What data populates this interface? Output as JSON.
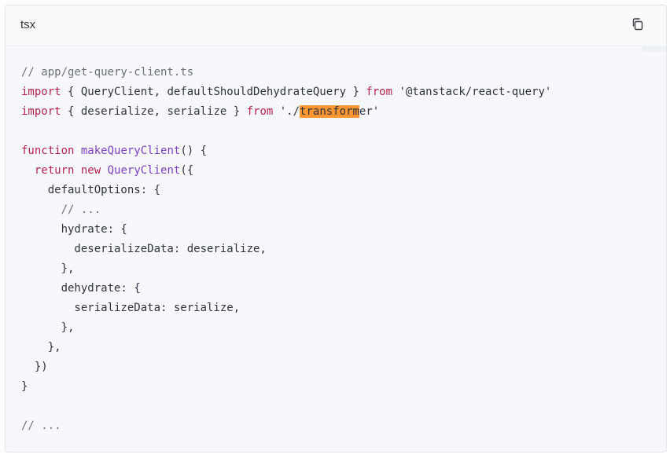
{
  "code_block": {
    "language": "tsx",
    "copy_icon": "copy-icon",
    "lines": [
      [
        {
          "t": "// app/get-query-client.ts",
          "c": "cm"
        }
      ],
      [
        {
          "t": "import",
          "c": "kw"
        },
        {
          "t": " { QueryClient, defaultShouldDehydrateQuery } ",
          "c": ""
        },
        {
          "t": "from",
          "c": "kw"
        },
        {
          "t": " '@tanstack/react-query'",
          "c": "str"
        }
      ],
      [
        {
          "t": "import",
          "c": "kw"
        },
        {
          "t": " { deserialize, serialize } ",
          "c": ""
        },
        {
          "t": "from",
          "c": "kw"
        },
        {
          "t": " './",
          "c": "str"
        },
        {
          "t": "transform",
          "c": "hl"
        },
        {
          "t": "er'",
          "c": "str"
        }
      ],
      [
        {
          "t": "",
          "c": ""
        }
      ],
      [
        {
          "t": "function",
          "c": "kw"
        },
        {
          "t": " ",
          "c": ""
        },
        {
          "t": "makeQueryClient",
          "c": "fn"
        },
        {
          "t": "() {",
          "c": ""
        }
      ],
      [
        {
          "t": "  ",
          "c": ""
        },
        {
          "t": "return",
          "c": "kw"
        },
        {
          "t": " ",
          "c": ""
        },
        {
          "t": "new",
          "c": "kw"
        },
        {
          "t": " ",
          "c": ""
        },
        {
          "t": "QueryClient",
          "c": "fn"
        },
        {
          "t": "({",
          "c": ""
        }
      ],
      [
        {
          "t": "    defaultOptions: {",
          "c": ""
        }
      ],
      [
        {
          "t": "      ",
          "c": ""
        },
        {
          "t": "// ...",
          "c": "cm"
        }
      ],
      [
        {
          "t": "      hydrate: {",
          "c": ""
        }
      ],
      [
        {
          "t": "        deserializeData: deserialize,",
          "c": ""
        }
      ],
      [
        {
          "t": "      },",
          "c": ""
        }
      ],
      [
        {
          "t": "      dehydrate: {",
          "c": ""
        }
      ],
      [
        {
          "t": "        serializeData: serialize,",
          "c": ""
        }
      ],
      [
        {
          "t": "      },",
          "c": ""
        }
      ],
      [
        {
          "t": "    },",
          "c": ""
        }
      ],
      [
        {
          "t": "  })",
          "c": ""
        }
      ],
      [
        {
          "t": "}",
          "c": ""
        }
      ],
      [
        {
          "t": "",
          "c": ""
        }
      ],
      [
        {
          "t": "// ...",
          "c": "cm"
        }
      ]
    ]
  }
}
